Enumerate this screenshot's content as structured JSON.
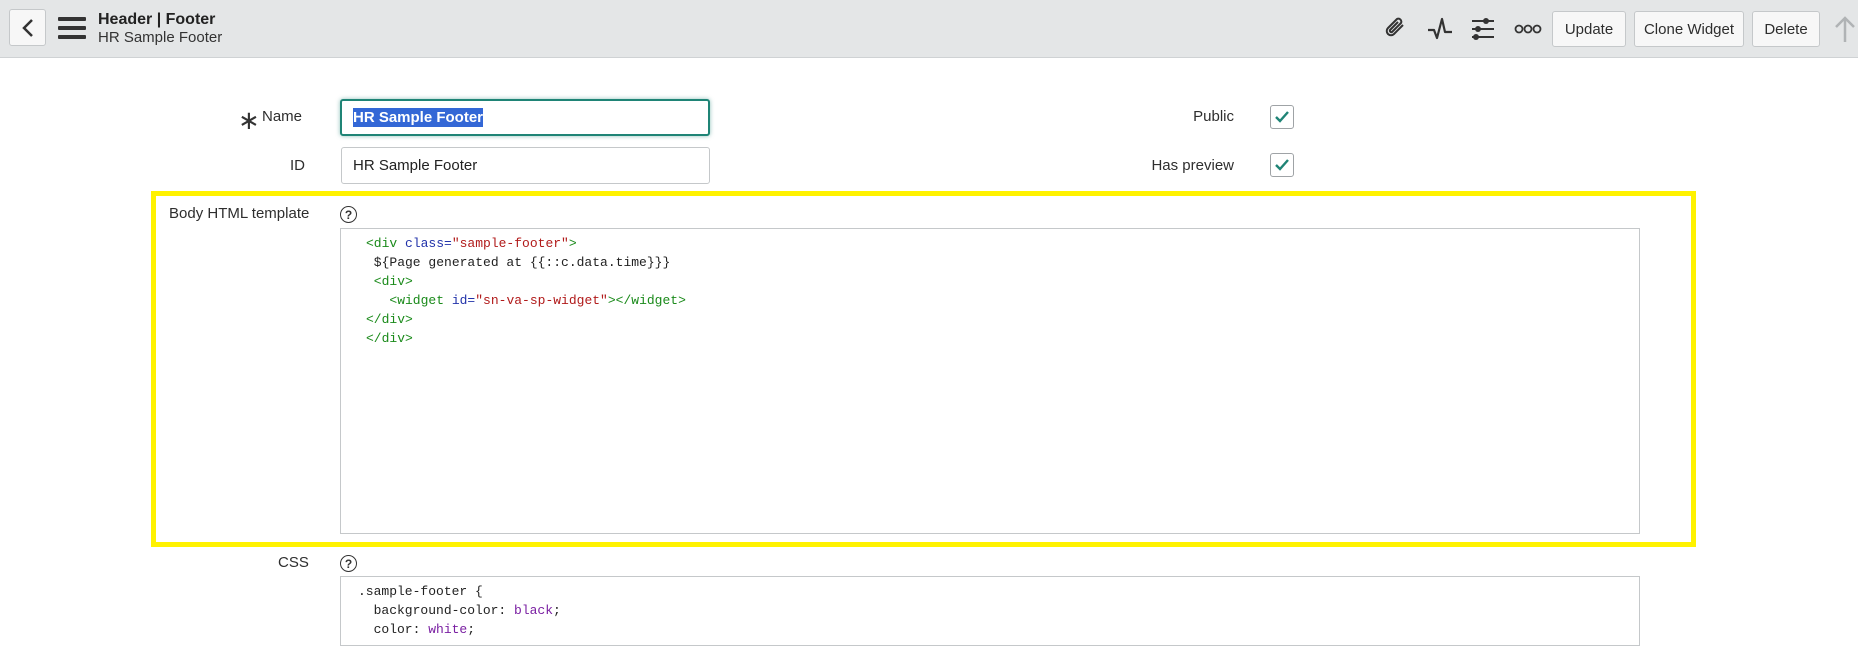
{
  "header": {
    "title": "Header | Footer",
    "subtitle": "HR Sample Footer",
    "buttons": {
      "update": "Update",
      "clone": "Clone Widget",
      "delete": "Delete"
    },
    "icons": [
      "back-icon",
      "menu-icon",
      "paperclip-icon",
      "activity-icon",
      "sliders-icon",
      "more-icon",
      "arrow-up-icon"
    ]
  },
  "form": {
    "name_label": "Name",
    "name_value": "HR Sample Footer",
    "id_label": "ID",
    "id_value": "HR Sample Footer",
    "public_label": "Public",
    "public_checked": true,
    "has_preview_label": "Has preview",
    "has_preview_checked": true,
    "body_html_label": "Body HTML template",
    "css_label": "CSS",
    "help_glyph": "?"
  },
  "body_html_code": [
    {
      "tokens": [
        {
          "t": "tag",
          "v": "<div "
        },
        {
          "t": "attr",
          "v": "class="
        },
        {
          "t": "str",
          "v": "\"sample-footer\""
        },
        {
          "t": "tag",
          "v": ">"
        }
      ]
    },
    {
      "tokens": [
        {
          "t": "plain",
          "v": " ${Page generated at {{::c.data.time}}}"
        }
      ]
    },
    {
      "tokens": [
        {
          "t": "tag",
          "v": " <div>"
        }
      ]
    },
    {
      "tokens": [
        {
          "t": "tag",
          "v": "   <widget "
        },
        {
          "t": "attr",
          "v": "id="
        },
        {
          "t": "str",
          "v": "\"sn-va-sp-widget\""
        },
        {
          "t": "tag",
          "v": "></widget>"
        }
      ]
    },
    {
      "tokens": [
        {
          "t": "tag",
          "v": "</div>"
        }
      ]
    },
    {
      "tokens": [
        {
          "t": "tag",
          "v": "</div>"
        }
      ]
    }
  ],
  "css_code": [
    {
      "tokens": [
        {
          "t": "plain",
          "v": ".sample-footer {"
        }
      ]
    },
    {
      "tokens": [
        {
          "t": "prop",
          "v": "  background-color: "
        },
        {
          "t": "kw",
          "v": "black"
        },
        {
          "t": "prop",
          "v": ";"
        }
      ]
    },
    {
      "tokens": [
        {
          "t": "prop",
          "v": "  color: "
        },
        {
          "t": "kw",
          "v": "white"
        },
        {
          "t": "prop",
          "v": ";"
        }
      ]
    }
  ],
  "colors": {
    "highlight": "#fff200",
    "focus": "#1f8476",
    "check": "#1f8476",
    "selection": "#3367d6"
  }
}
